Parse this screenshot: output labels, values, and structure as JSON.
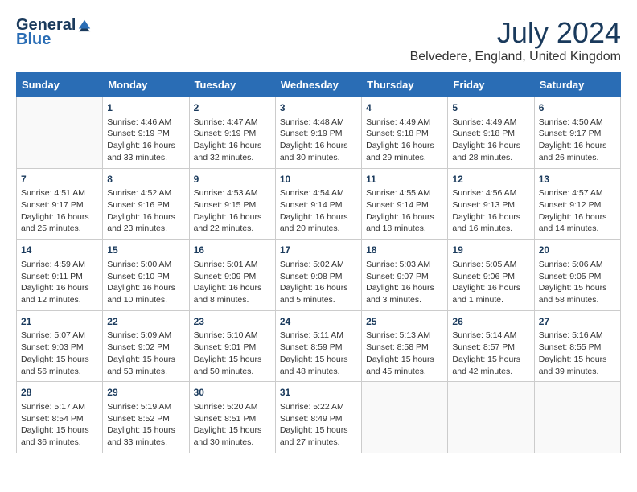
{
  "header": {
    "logo_line1": "General",
    "logo_line2": "Blue",
    "title": "July 2024",
    "location": "Belvedere, England, United Kingdom"
  },
  "weekdays": [
    "Sunday",
    "Monday",
    "Tuesday",
    "Wednesday",
    "Thursday",
    "Friday",
    "Saturday"
  ],
  "weeks": [
    [
      {
        "day": "",
        "content": ""
      },
      {
        "day": "1",
        "content": "Sunrise: 4:46 AM\nSunset: 9:19 PM\nDaylight: 16 hours\nand 33 minutes."
      },
      {
        "day": "2",
        "content": "Sunrise: 4:47 AM\nSunset: 9:19 PM\nDaylight: 16 hours\nand 32 minutes."
      },
      {
        "day": "3",
        "content": "Sunrise: 4:48 AM\nSunset: 9:19 PM\nDaylight: 16 hours\nand 30 minutes."
      },
      {
        "day": "4",
        "content": "Sunrise: 4:49 AM\nSunset: 9:18 PM\nDaylight: 16 hours\nand 29 minutes."
      },
      {
        "day": "5",
        "content": "Sunrise: 4:49 AM\nSunset: 9:18 PM\nDaylight: 16 hours\nand 28 minutes."
      },
      {
        "day": "6",
        "content": "Sunrise: 4:50 AM\nSunset: 9:17 PM\nDaylight: 16 hours\nand 26 minutes."
      }
    ],
    [
      {
        "day": "7",
        "content": "Sunrise: 4:51 AM\nSunset: 9:17 PM\nDaylight: 16 hours\nand 25 minutes."
      },
      {
        "day": "8",
        "content": "Sunrise: 4:52 AM\nSunset: 9:16 PM\nDaylight: 16 hours\nand 23 minutes."
      },
      {
        "day": "9",
        "content": "Sunrise: 4:53 AM\nSunset: 9:15 PM\nDaylight: 16 hours\nand 22 minutes."
      },
      {
        "day": "10",
        "content": "Sunrise: 4:54 AM\nSunset: 9:14 PM\nDaylight: 16 hours\nand 20 minutes."
      },
      {
        "day": "11",
        "content": "Sunrise: 4:55 AM\nSunset: 9:14 PM\nDaylight: 16 hours\nand 18 minutes."
      },
      {
        "day": "12",
        "content": "Sunrise: 4:56 AM\nSunset: 9:13 PM\nDaylight: 16 hours\nand 16 minutes."
      },
      {
        "day": "13",
        "content": "Sunrise: 4:57 AM\nSunset: 9:12 PM\nDaylight: 16 hours\nand 14 minutes."
      }
    ],
    [
      {
        "day": "14",
        "content": "Sunrise: 4:59 AM\nSunset: 9:11 PM\nDaylight: 16 hours\nand 12 minutes."
      },
      {
        "day": "15",
        "content": "Sunrise: 5:00 AM\nSunset: 9:10 PM\nDaylight: 16 hours\nand 10 minutes."
      },
      {
        "day": "16",
        "content": "Sunrise: 5:01 AM\nSunset: 9:09 PM\nDaylight: 16 hours\nand 8 minutes."
      },
      {
        "day": "17",
        "content": "Sunrise: 5:02 AM\nSunset: 9:08 PM\nDaylight: 16 hours\nand 5 minutes."
      },
      {
        "day": "18",
        "content": "Sunrise: 5:03 AM\nSunset: 9:07 PM\nDaylight: 16 hours\nand 3 minutes."
      },
      {
        "day": "19",
        "content": "Sunrise: 5:05 AM\nSunset: 9:06 PM\nDaylight: 16 hours\nand 1 minute."
      },
      {
        "day": "20",
        "content": "Sunrise: 5:06 AM\nSunset: 9:05 PM\nDaylight: 15 hours\nand 58 minutes."
      }
    ],
    [
      {
        "day": "21",
        "content": "Sunrise: 5:07 AM\nSunset: 9:03 PM\nDaylight: 15 hours\nand 56 minutes."
      },
      {
        "day": "22",
        "content": "Sunrise: 5:09 AM\nSunset: 9:02 PM\nDaylight: 15 hours\nand 53 minutes."
      },
      {
        "day": "23",
        "content": "Sunrise: 5:10 AM\nSunset: 9:01 PM\nDaylight: 15 hours\nand 50 minutes."
      },
      {
        "day": "24",
        "content": "Sunrise: 5:11 AM\nSunset: 8:59 PM\nDaylight: 15 hours\nand 48 minutes."
      },
      {
        "day": "25",
        "content": "Sunrise: 5:13 AM\nSunset: 8:58 PM\nDaylight: 15 hours\nand 45 minutes."
      },
      {
        "day": "26",
        "content": "Sunrise: 5:14 AM\nSunset: 8:57 PM\nDaylight: 15 hours\nand 42 minutes."
      },
      {
        "day": "27",
        "content": "Sunrise: 5:16 AM\nSunset: 8:55 PM\nDaylight: 15 hours\nand 39 minutes."
      }
    ],
    [
      {
        "day": "28",
        "content": "Sunrise: 5:17 AM\nSunset: 8:54 PM\nDaylight: 15 hours\nand 36 minutes."
      },
      {
        "day": "29",
        "content": "Sunrise: 5:19 AM\nSunset: 8:52 PM\nDaylight: 15 hours\nand 33 minutes."
      },
      {
        "day": "30",
        "content": "Sunrise: 5:20 AM\nSunset: 8:51 PM\nDaylight: 15 hours\nand 30 minutes."
      },
      {
        "day": "31",
        "content": "Sunrise: 5:22 AM\nSunset: 8:49 PM\nDaylight: 15 hours\nand 27 minutes."
      },
      {
        "day": "",
        "content": ""
      },
      {
        "day": "",
        "content": ""
      },
      {
        "day": "",
        "content": ""
      }
    ]
  ]
}
